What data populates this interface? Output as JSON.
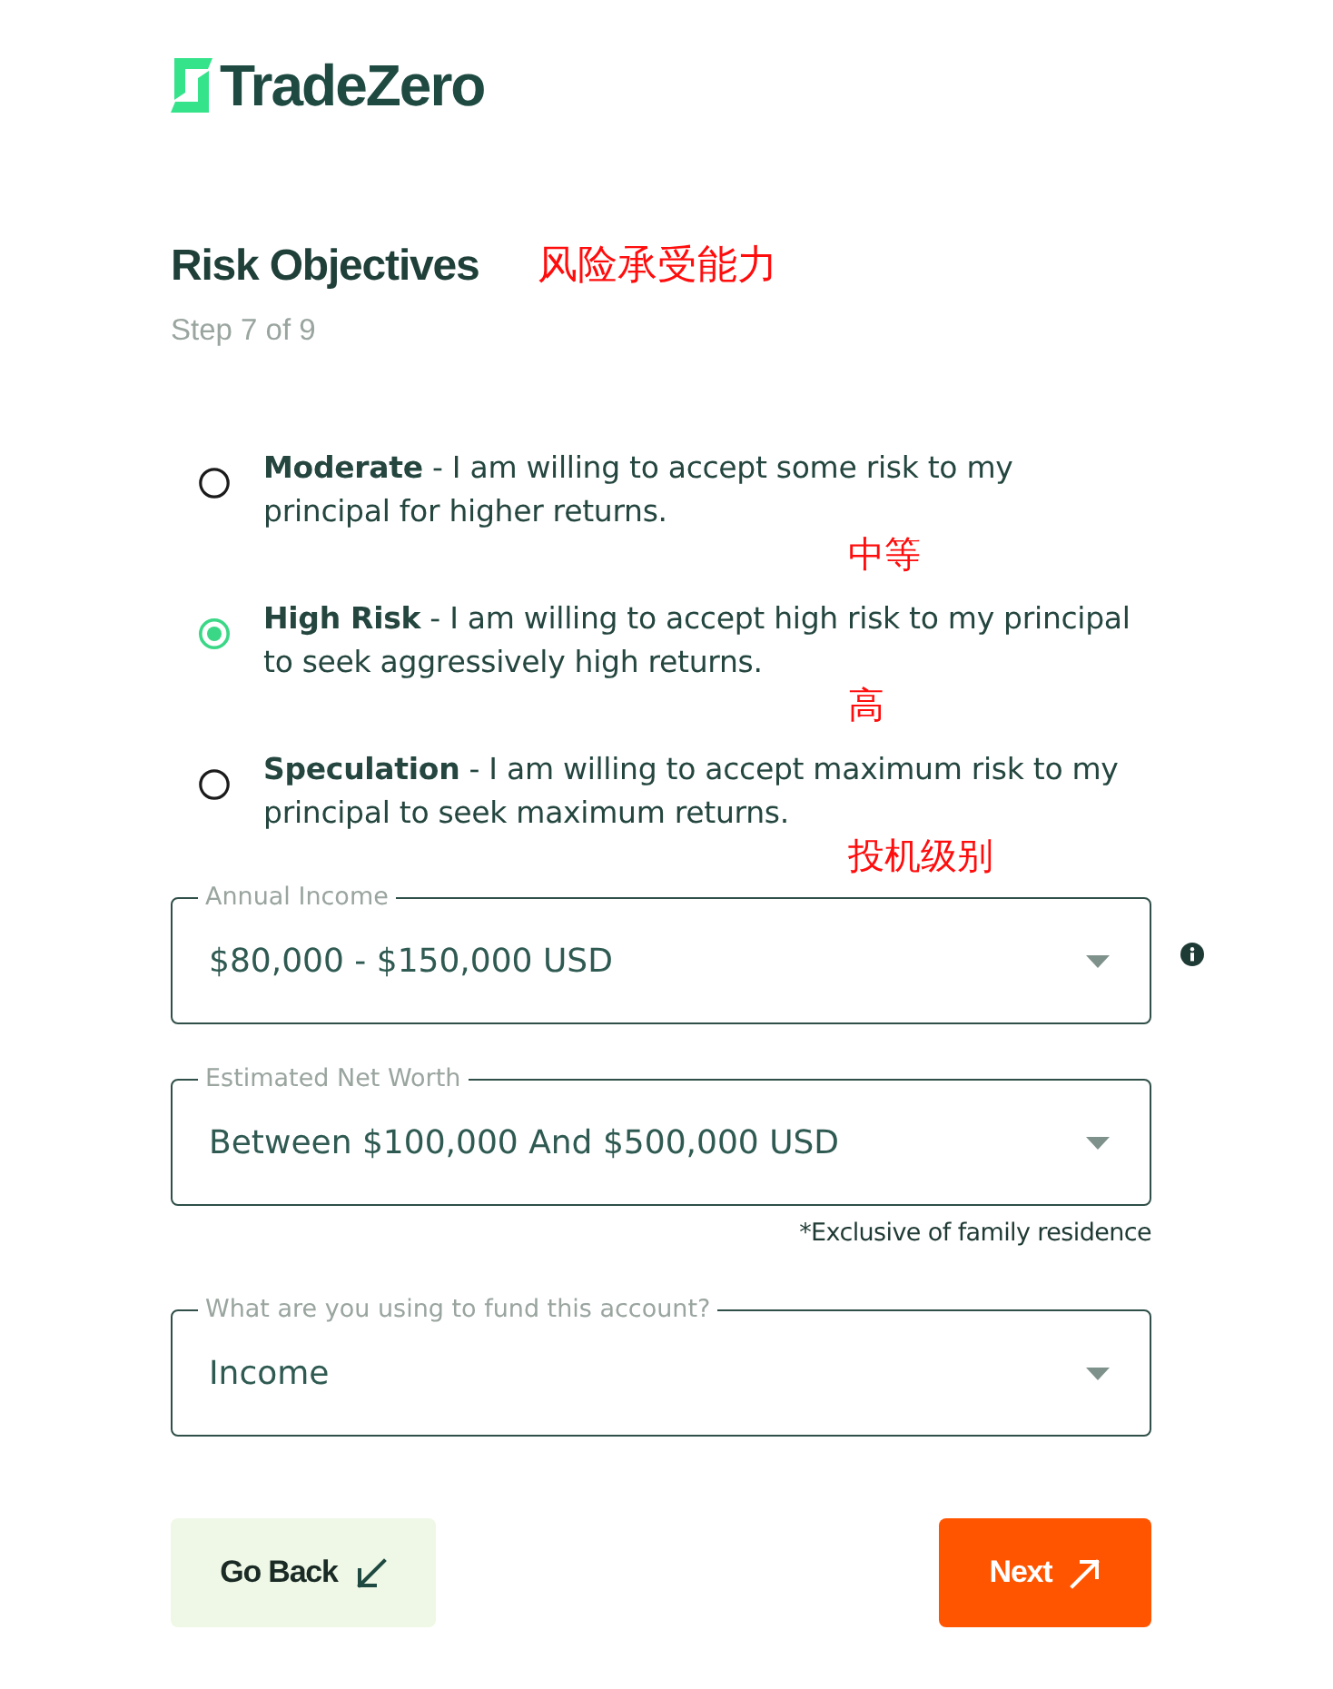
{
  "logo": {
    "text": "TradeZero"
  },
  "heading": {
    "title": "Risk Objectives",
    "annotation": "风险承受能力",
    "step": "Step 7 of 9"
  },
  "risk_options": [
    {
      "text": "**Moderate** - I am willing to accept some risk to my principal for higher returns.",
      "selected": false,
      "annotation": "中等"
    },
    {
      "text": "**High Risk** - I am willing to accept high risk to my principal to seek aggressively high returns.",
      "selected": true,
      "annotation": "高"
    },
    {
      "text": "**Speculation** - I am willing to accept maximum risk to my principal to seek maximum returns.",
      "selected": false,
      "annotation": "投机级别"
    }
  ],
  "fields": [
    {
      "label": "Annual Income",
      "value": "$80,000 - $150,000 USD",
      "info": true
    },
    {
      "label": "Estimated Net Worth",
      "value": "Between $100,000 And $500,000 USD",
      "info": false,
      "note": "*Exclusive of family residence"
    },
    {
      "label": "What are you using to fund this account?",
      "value": "Income",
      "info": false
    }
  ],
  "buttons": [
    {
      "label": "Go Back",
      "kind": "back"
    },
    {
      "label": "Next",
      "kind": "next"
    }
  ]
}
